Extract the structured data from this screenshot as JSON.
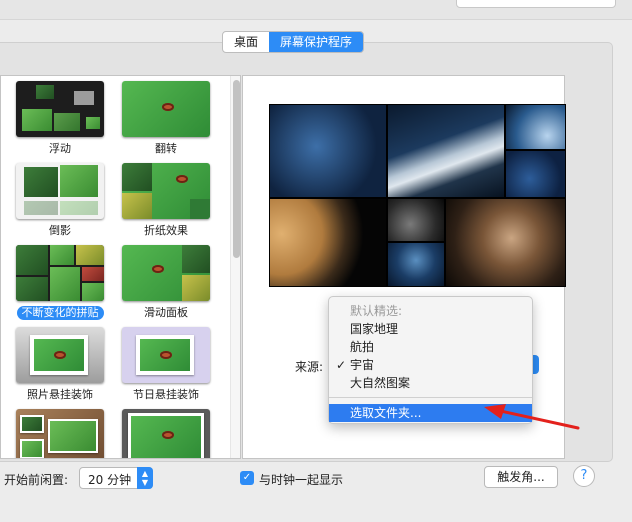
{
  "tabs": [
    {
      "label": "桌面",
      "active": false
    },
    {
      "label": "屏幕保护程序",
      "active": true
    }
  ],
  "screensavers": [
    {
      "label": "浮动",
      "selected": false
    },
    {
      "label": "翻转",
      "selected": false
    },
    {
      "label": "倒影",
      "selected": false
    },
    {
      "label": "折纸效果",
      "selected": false
    },
    {
      "label": "不断变化的拼贴",
      "selected": true
    },
    {
      "label": "滑动面板",
      "selected": false
    },
    {
      "label": "照片悬挂装饰",
      "selected": false
    },
    {
      "label": "节日悬挂装饰",
      "selected": false
    }
  ],
  "source": {
    "label": "来源:",
    "menu": {
      "header": "默认精选:",
      "items": [
        "国家地理",
        "航拍",
        "宇宙",
        "大自然图案"
      ],
      "checked_item": "宇宙",
      "check_mark": "✓",
      "choose_folder": "选取文件夹..."
    }
  },
  "bottom": {
    "idle_label": "开始前闲置:",
    "idle_value": "20 分钟",
    "show_clock_label": "与时钟一起显示",
    "show_clock_checked": true,
    "hot_corners_label": "触发角...",
    "help_label": "?"
  },
  "colors": {
    "accent": "#2d8cf6",
    "arrow": "#e3211c"
  }
}
